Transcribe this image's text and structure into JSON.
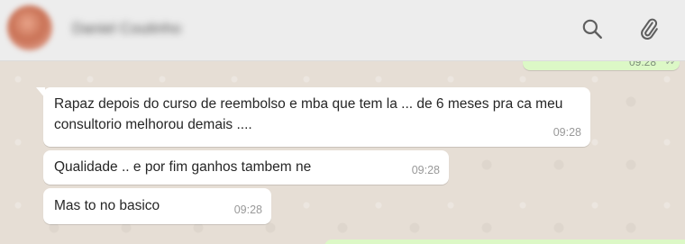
{
  "header": {
    "contact_name": "Daniel Coutinho",
    "search_icon": "search-icon",
    "attach_icon": "paperclip-icon"
  },
  "colors": {
    "header_bg": "#ededed",
    "chat_bg": "#e5ddd5",
    "incoming_bubble": "#ffffff",
    "outgoing_bubble": "#dcf8c6"
  },
  "outgoing_partial": {
    "time": "09:28",
    "status_icon": "double-check-icon"
  },
  "messages": [
    {
      "text": "Rapaz depois do curso de reembolso e mba que tem la ... de 6 meses pra ca meu consultorio melhorou demais ....",
      "time": "09:28"
    },
    {
      "text": "Qualidade .. e por fim ganhos tambem ne",
      "time": "09:28"
    },
    {
      "text": "Mas to no basico",
      "time": "09:28"
    }
  ]
}
